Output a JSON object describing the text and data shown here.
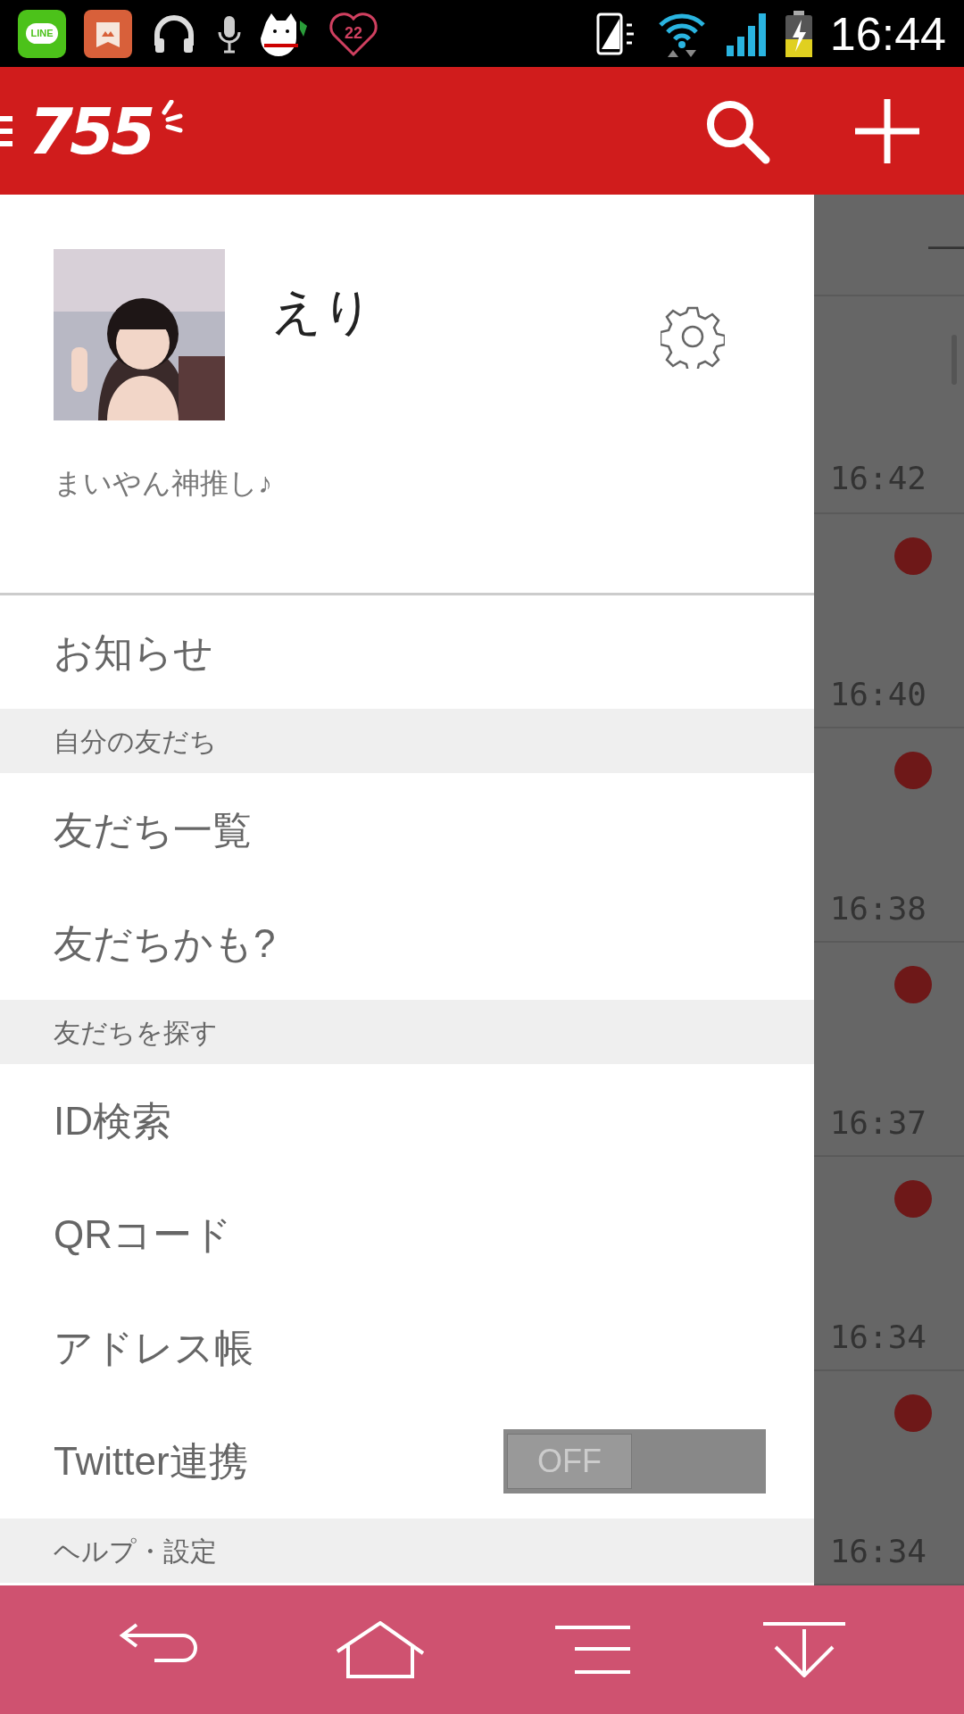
{
  "status_bar": {
    "app_icons": [
      {
        "kind": "line",
        "label": "LINE"
      },
      {
        "kind": "store"
      },
      {
        "kind": "headphones"
      },
      {
        "kind": "mic"
      },
      {
        "kind": "dog"
      },
      {
        "kind": "heart",
        "label": "22"
      }
    ],
    "time": "16:44"
  },
  "header": {
    "logo": "755"
  },
  "profile": {
    "name": "えり",
    "status": "まいやん神推し♪"
  },
  "menu": [
    {
      "kind": "item",
      "label": "お知らせ"
    },
    {
      "kind": "section",
      "label": "自分の友だち"
    },
    {
      "kind": "item",
      "label": "友だち一覧"
    },
    {
      "kind": "item",
      "label": "友だちかも?"
    },
    {
      "kind": "section",
      "label": "友だちを探す"
    },
    {
      "kind": "item",
      "label": "ID検索"
    },
    {
      "kind": "item",
      "label": "QRコード"
    },
    {
      "kind": "item",
      "label": "アドレス帳"
    },
    {
      "kind": "toggle",
      "label": "Twitter連携",
      "on": false,
      "state_label": "OFF"
    },
    {
      "kind": "section",
      "label": "ヘルプ・設定"
    }
  ],
  "background_list": {
    "header_fragment": "—",
    "rows": [
      {
        "time": "16:42",
        "unread": false
      },
      {
        "time": "16:40",
        "unread": true
      },
      {
        "time": "16:38",
        "unread": true
      },
      {
        "time": "16:37",
        "unread": true
      },
      {
        "time": "16:34",
        "unread": true
      },
      {
        "time": "16:34",
        "unread": true
      }
    ]
  }
}
